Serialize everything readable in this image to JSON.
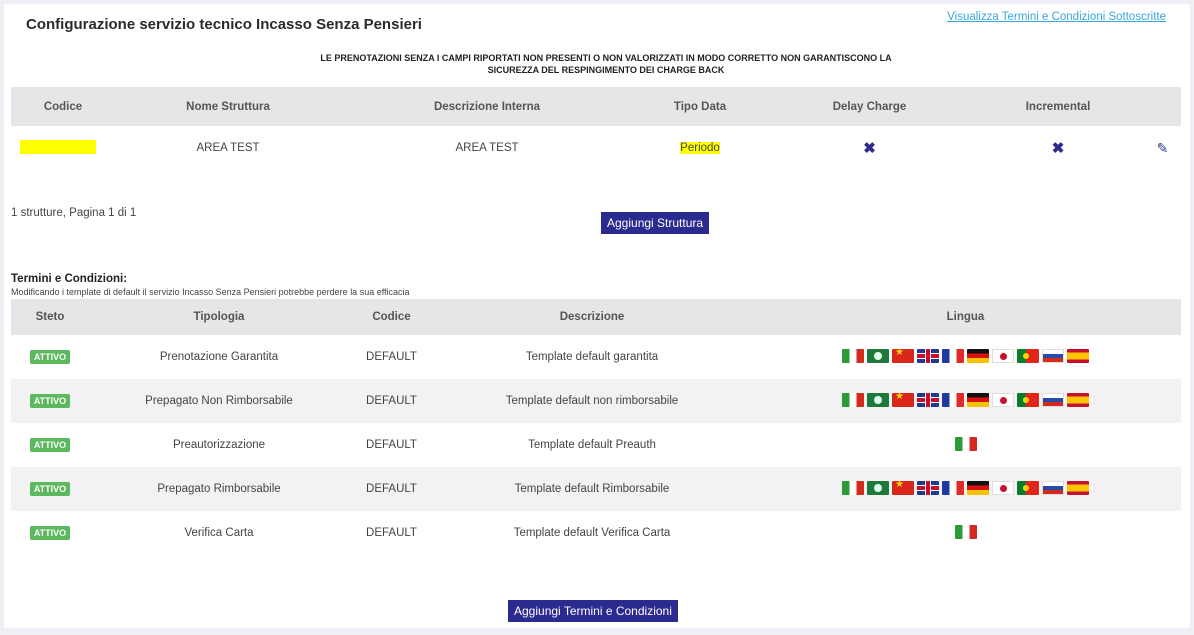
{
  "header": {
    "title": "Configurazione servizio tecnico Incasso Senza Pensieri",
    "tc_link": "Visualizza Termini e Condizioni Sottoscritte"
  },
  "warning": "LE PRENOTAZIONI SENZA I CAMPI RIPORTATI NON PRESENTI O NON VALORIZZATI IN MODO CORRETTO NON GARANTISCONO LA SICUREZZA DEL RESPINGIMENTO DEI CHARGE BACK",
  "structures": {
    "columns": [
      "Codice",
      "Nome Struttura",
      "Descrizione Interna",
      "Tipo Data",
      "Delay Charge",
      "Incremental"
    ],
    "rows": [
      {
        "codice": "",
        "nome": "AREA TEST",
        "descrizione": "AREA TEST",
        "tipo_data": "Periodo",
        "delay_charge": "✖",
        "incremental": "✖"
      }
    ],
    "page_info": "1 strutture, Pagina 1 di 1",
    "add_button": "Aggiungi Struttura"
  },
  "terms": {
    "heading": "Termini e Condizioni:",
    "note": "Modificando i template di default il servizio Incasso Senza Pensieri potrebbe perdere la sua efficacia",
    "columns": [
      "Steto",
      "Tipologia",
      "Codice",
      "Descrizione",
      "Lingua"
    ],
    "rows": [
      {
        "stato": "ATTIVO",
        "tipologia": "Prenotazione Garantita",
        "codice": "DEFAULT",
        "descrizione": "Template default garantita",
        "lingue": [
          "it",
          "ar",
          "cn",
          "gb",
          "fr",
          "de",
          "jp",
          "pt",
          "ru",
          "es"
        ]
      },
      {
        "stato": "ATTIVO",
        "tipologia": "Prepagato Non Rimborsabile",
        "codice": "DEFAULT",
        "descrizione": "Template default non rimborsabile",
        "lingue": [
          "it",
          "ar",
          "cn",
          "gb",
          "fr",
          "de",
          "jp",
          "pt",
          "ru",
          "es"
        ]
      },
      {
        "stato": "ATTIVO",
        "tipologia": "Preautorizzazione",
        "codice": "DEFAULT",
        "descrizione": "Template default Preauth",
        "lingue": [
          "it"
        ]
      },
      {
        "stato": "ATTIVO",
        "tipologia": "Prepagato Rimborsabile",
        "codice": "DEFAULT",
        "descrizione": "Template default Rimborsabile",
        "lingue": [
          "it",
          "ar",
          "cn",
          "gb",
          "fr",
          "de",
          "jp",
          "pt",
          "ru",
          "es"
        ]
      },
      {
        "stato": "ATTIVO",
        "tipologia": "Verifica Carta",
        "codice": "DEFAULT",
        "descrizione": "Template default Verifica Carta",
        "lingue": [
          "it"
        ]
      }
    ],
    "add_button": "Aggiungi Termini e Condizioni"
  },
  "colors": {
    "accent": "#2b2a8e",
    "highlight": "#ffff00",
    "active_badge": "#5cb85c",
    "link": "#3ca6d8"
  }
}
